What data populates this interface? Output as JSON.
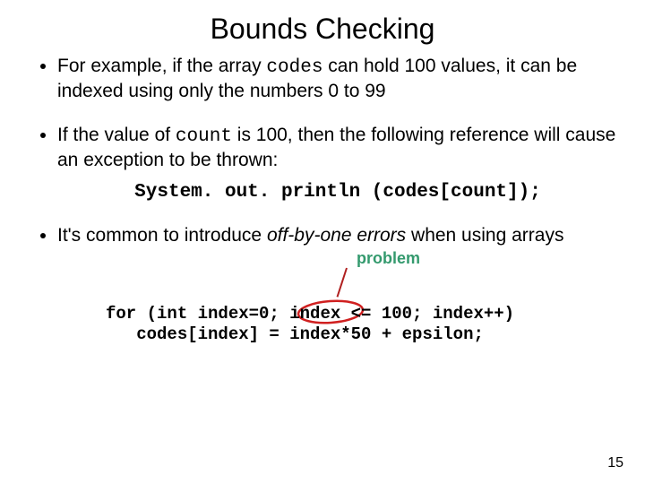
{
  "title": "Bounds Checking",
  "bullets": {
    "b1a": "For example, if the array ",
    "b1code": "codes",
    "b1b": " can hold 100 values, it can be indexed using only the numbers 0 to 99",
    "b2a": "If the value of ",
    "b2code": "count",
    "b2b": " is 100, then the following reference will cause an exception to be thrown:",
    "b3a": "It's common to introduce ",
    "b3italic": "off-by-one errors",
    "b3b": " when using arrays"
  },
  "code_center": "System. out. println (codes[count]);",
  "annotation": "problem",
  "code_block": "for (int index=0; index <= 100; index++)\n   codes[index] = index*50 + epsilon;",
  "page_number": "15"
}
